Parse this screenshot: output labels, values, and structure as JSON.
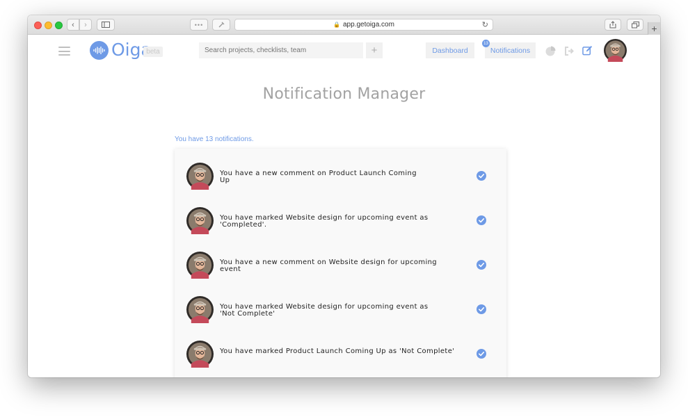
{
  "browser": {
    "url": "app.getoiga.com",
    "toolbar_dots": "•••"
  },
  "header": {
    "logo": "Oiga",
    "beta": "beta",
    "search_placeholder": "Search projects, checklists, team",
    "add_label": "+",
    "dashboard_label": "Dashboard",
    "notifications_label": "Notifications",
    "notifications_badge": "13"
  },
  "main": {
    "title": "Notification Manager",
    "count_text": "You have 13 notifications.",
    "notifications": [
      {
        "text": "You have a new comment on Product Launch Coming Up"
      },
      {
        "text": "You have marked Website design for upcoming event as 'Completed'."
      },
      {
        "text": "You have a new comment on Website design for upcoming event"
      },
      {
        "text": "You have marked Website design for upcoming event as 'Not Complete'"
      },
      {
        "text": "You have marked Product Launch Coming Up as 'Not Complete'"
      }
    ]
  },
  "colors": {
    "accent": "#6e9ae6",
    "title_gray": "#a2a2a2",
    "card_bg": "#f9f9f9"
  },
  "icons": [
    "search-icon",
    "lock-icon",
    "reload-icon",
    "chart-icon",
    "exit-icon",
    "edit-icon",
    "check-circle-icon"
  ]
}
